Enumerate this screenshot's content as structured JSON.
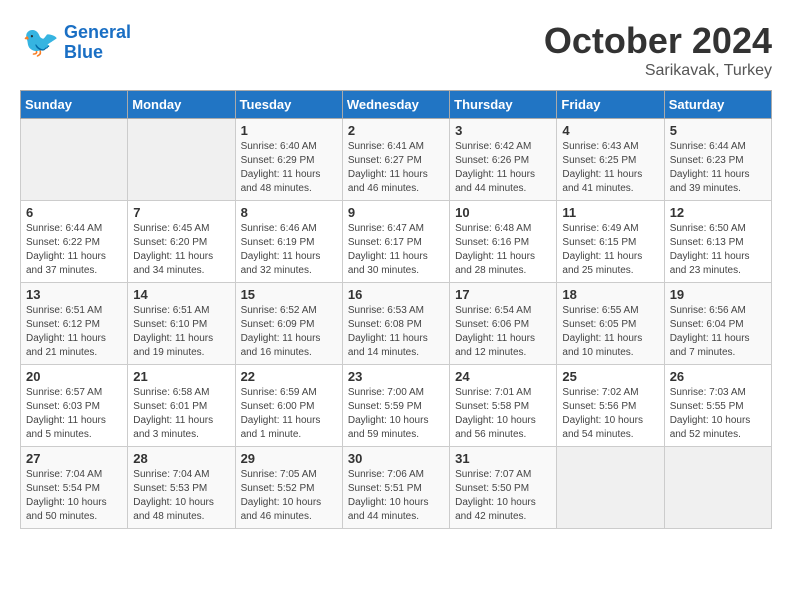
{
  "header": {
    "logo_line1": "General",
    "logo_line2": "Blue",
    "month": "October 2024",
    "location": "Sarikavak, Turkey"
  },
  "days_of_week": [
    "Sunday",
    "Monday",
    "Tuesday",
    "Wednesday",
    "Thursday",
    "Friday",
    "Saturday"
  ],
  "weeks": [
    [
      {
        "day": "",
        "sunrise": "",
        "sunset": "",
        "daylight": ""
      },
      {
        "day": "",
        "sunrise": "",
        "sunset": "",
        "daylight": ""
      },
      {
        "day": "1",
        "sunrise": "Sunrise: 6:40 AM",
        "sunset": "Sunset: 6:29 PM",
        "daylight": "Daylight: 11 hours and 48 minutes."
      },
      {
        "day": "2",
        "sunrise": "Sunrise: 6:41 AM",
        "sunset": "Sunset: 6:27 PM",
        "daylight": "Daylight: 11 hours and 46 minutes."
      },
      {
        "day": "3",
        "sunrise": "Sunrise: 6:42 AM",
        "sunset": "Sunset: 6:26 PM",
        "daylight": "Daylight: 11 hours and 44 minutes."
      },
      {
        "day": "4",
        "sunrise": "Sunrise: 6:43 AM",
        "sunset": "Sunset: 6:25 PM",
        "daylight": "Daylight: 11 hours and 41 minutes."
      },
      {
        "day": "5",
        "sunrise": "Sunrise: 6:44 AM",
        "sunset": "Sunset: 6:23 PM",
        "daylight": "Daylight: 11 hours and 39 minutes."
      }
    ],
    [
      {
        "day": "6",
        "sunrise": "Sunrise: 6:44 AM",
        "sunset": "Sunset: 6:22 PM",
        "daylight": "Daylight: 11 hours and 37 minutes."
      },
      {
        "day": "7",
        "sunrise": "Sunrise: 6:45 AM",
        "sunset": "Sunset: 6:20 PM",
        "daylight": "Daylight: 11 hours and 34 minutes."
      },
      {
        "day": "8",
        "sunrise": "Sunrise: 6:46 AM",
        "sunset": "Sunset: 6:19 PM",
        "daylight": "Daylight: 11 hours and 32 minutes."
      },
      {
        "day": "9",
        "sunrise": "Sunrise: 6:47 AM",
        "sunset": "Sunset: 6:17 PM",
        "daylight": "Daylight: 11 hours and 30 minutes."
      },
      {
        "day": "10",
        "sunrise": "Sunrise: 6:48 AM",
        "sunset": "Sunset: 6:16 PM",
        "daylight": "Daylight: 11 hours and 28 minutes."
      },
      {
        "day": "11",
        "sunrise": "Sunrise: 6:49 AM",
        "sunset": "Sunset: 6:15 PM",
        "daylight": "Daylight: 11 hours and 25 minutes."
      },
      {
        "day": "12",
        "sunrise": "Sunrise: 6:50 AM",
        "sunset": "Sunset: 6:13 PM",
        "daylight": "Daylight: 11 hours and 23 minutes."
      }
    ],
    [
      {
        "day": "13",
        "sunrise": "Sunrise: 6:51 AM",
        "sunset": "Sunset: 6:12 PM",
        "daylight": "Daylight: 11 hours and 21 minutes."
      },
      {
        "day": "14",
        "sunrise": "Sunrise: 6:51 AM",
        "sunset": "Sunset: 6:10 PM",
        "daylight": "Daylight: 11 hours and 19 minutes."
      },
      {
        "day": "15",
        "sunrise": "Sunrise: 6:52 AM",
        "sunset": "Sunset: 6:09 PM",
        "daylight": "Daylight: 11 hours and 16 minutes."
      },
      {
        "day": "16",
        "sunrise": "Sunrise: 6:53 AM",
        "sunset": "Sunset: 6:08 PM",
        "daylight": "Daylight: 11 hours and 14 minutes."
      },
      {
        "day": "17",
        "sunrise": "Sunrise: 6:54 AM",
        "sunset": "Sunset: 6:06 PM",
        "daylight": "Daylight: 11 hours and 12 minutes."
      },
      {
        "day": "18",
        "sunrise": "Sunrise: 6:55 AM",
        "sunset": "Sunset: 6:05 PM",
        "daylight": "Daylight: 11 hours and 10 minutes."
      },
      {
        "day": "19",
        "sunrise": "Sunrise: 6:56 AM",
        "sunset": "Sunset: 6:04 PM",
        "daylight": "Daylight: 11 hours and 7 minutes."
      }
    ],
    [
      {
        "day": "20",
        "sunrise": "Sunrise: 6:57 AM",
        "sunset": "Sunset: 6:03 PM",
        "daylight": "Daylight: 11 hours and 5 minutes."
      },
      {
        "day": "21",
        "sunrise": "Sunrise: 6:58 AM",
        "sunset": "Sunset: 6:01 PM",
        "daylight": "Daylight: 11 hours and 3 minutes."
      },
      {
        "day": "22",
        "sunrise": "Sunrise: 6:59 AM",
        "sunset": "Sunset: 6:00 PM",
        "daylight": "Daylight: 11 hours and 1 minute."
      },
      {
        "day": "23",
        "sunrise": "Sunrise: 7:00 AM",
        "sunset": "Sunset: 5:59 PM",
        "daylight": "Daylight: 10 hours and 59 minutes."
      },
      {
        "day": "24",
        "sunrise": "Sunrise: 7:01 AM",
        "sunset": "Sunset: 5:58 PM",
        "daylight": "Daylight: 10 hours and 56 minutes."
      },
      {
        "day": "25",
        "sunrise": "Sunrise: 7:02 AM",
        "sunset": "Sunset: 5:56 PM",
        "daylight": "Daylight: 10 hours and 54 minutes."
      },
      {
        "day": "26",
        "sunrise": "Sunrise: 7:03 AM",
        "sunset": "Sunset: 5:55 PM",
        "daylight": "Daylight: 10 hours and 52 minutes."
      }
    ],
    [
      {
        "day": "27",
        "sunrise": "Sunrise: 7:04 AM",
        "sunset": "Sunset: 5:54 PM",
        "daylight": "Daylight: 10 hours and 50 minutes."
      },
      {
        "day": "28",
        "sunrise": "Sunrise: 7:04 AM",
        "sunset": "Sunset: 5:53 PM",
        "daylight": "Daylight: 10 hours and 48 minutes."
      },
      {
        "day": "29",
        "sunrise": "Sunrise: 7:05 AM",
        "sunset": "Sunset: 5:52 PM",
        "daylight": "Daylight: 10 hours and 46 minutes."
      },
      {
        "day": "30",
        "sunrise": "Sunrise: 7:06 AM",
        "sunset": "Sunset: 5:51 PM",
        "daylight": "Daylight: 10 hours and 44 minutes."
      },
      {
        "day": "31",
        "sunrise": "Sunrise: 7:07 AM",
        "sunset": "Sunset: 5:50 PM",
        "daylight": "Daylight: 10 hours and 42 minutes."
      },
      {
        "day": "",
        "sunrise": "",
        "sunset": "",
        "daylight": ""
      },
      {
        "day": "",
        "sunrise": "",
        "sunset": "",
        "daylight": ""
      }
    ]
  ]
}
